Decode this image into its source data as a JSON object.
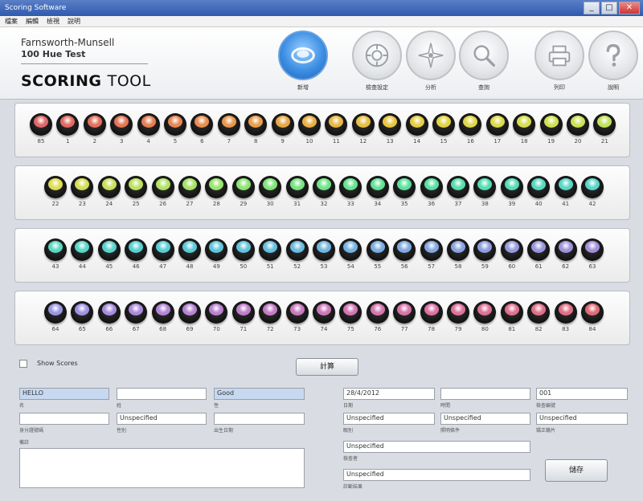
{
  "window": {
    "title": "Scoring Software",
    "min": "_",
    "max": "□",
    "close": "✕"
  },
  "menu": [
    "檔案",
    "編輯",
    "檢視",
    "說明"
  ],
  "brand": {
    "line1": "Farnsworth-Munsell",
    "line2": "100 Hue Test",
    "line3a": "SCORING",
    "line3b": "TOOL"
  },
  "toolbar": [
    {
      "id": "new",
      "label": "新增",
      "icon": "ring-icon",
      "active": true
    },
    {
      "id": "settings",
      "label": "檢查設定",
      "icon": "dial-icon",
      "active": false
    },
    {
      "id": "compass",
      "label": "分析",
      "icon": "compass-icon",
      "active": false
    },
    {
      "id": "search",
      "label": "查詢",
      "icon": "magnifier-icon",
      "active": false
    },
    {
      "id": "print",
      "label": "列印",
      "icon": "printer-icon",
      "active": false
    },
    {
      "id": "help",
      "label": "說明",
      "icon": "question-icon",
      "active": false
    }
  ],
  "caps": {
    "row1": [
      "85",
      "1",
      "2",
      "3",
      "4",
      "5",
      "6",
      "7",
      "8",
      "9",
      "10",
      "11",
      "12",
      "13",
      "14",
      "15",
      "16",
      "17",
      "18",
      "19",
      "20",
      "21"
    ],
    "row2": [
      "22",
      "23",
      "24",
      "25",
      "26",
      "27",
      "28",
      "29",
      "30",
      "31",
      "32",
      "33",
      "34",
      "35",
      "36",
      "37",
      "38",
      "39",
      "40",
      "41",
      "42"
    ],
    "row3": [
      "43",
      "44",
      "45",
      "46",
      "47",
      "48",
      "49",
      "50",
      "51",
      "52",
      "53",
      "54",
      "55",
      "56",
      "57",
      "58",
      "59",
      "60",
      "61",
      "62",
      "63"
    ],
    "row4": [
      "64",
      "65",
      "66",
      "67",
      "68",
      "69",
      "70",
      "71",
      "72",
      "73",
      "74",
      "75",
      "76",
      "77",
      "78",
      "79",
      "80",
      "81",
      "82",
      "83",
      "84"
    ]
  },
  "showScores": "Show Scores",
  "scoreButton": "計算",
  "saveButton": "儲存",
  "form": {
    "name": "HELLO",
    "nameLabel": "名",
    "middle": "",
    "middleLabel": "姓",
    "status": "Good",
    "statusLabel": "性",
    "id": "",
    "idLabel": "身分證號碼",
    "sex": "Unspecified",
    "sexLabel": "性別",
    "age": "",
    "ageLabel": "出生日期",
    "notesLabel": "備註",
    "date": "28/4/2012",
    "dateLabel": "日期",
    "field2": "",
    "field2Label": "時間",
    "field3": "001",
    "field3Label": "檢查編號",
    "eye": "Unspecified",
    "eyeLabel": "眼別",
    "light": "Unspecified",
    "lightLabel": "照明條件",
    "lens": "Unspecified",
    "lensLabel": "矯正鏡片",
    "examiner": "Unspecified",
    "examinerLabel": "檢查者",
    "diag": "Unspecified",
    "diagLabel": "診斷結果"
  },
  "colors": {
    "row1": [
      "#e06868",
      "#e26a62",
      "#e56f5c",
      "#e67658",
      "#e77f55",
      "#e88752",
      "#e98f50",
      "#ea974d",
      "#ea9f4b",
      "#eaa748",
      "#eaaf46",
      "#eab744",
      "#e9bf43",
      "#e8c643",
      "#e6cd44",
      "#e3d346",
      "#e0d748",
      "#dcdb4b",
      "#d7de4e",
      "#d1e052",
      "#cae256",
      "#c2e35a"
    ],
    "row2": [
      "#dedc52",
      "#d4de56",
      "#c9e05a",
      "#bde15e",
      "#b1e263",
      "#a5e368",
      "#99e46e",
      "#8de474",
      "#82e47a",
      "#78e481",
      "#6fe488",
      "#67e38f",
      "#61e296",
      "#5ce19d",
      "#58e0a4",
      "#56dfab",
      "#55ddb2",
      "#55dbb8",
      "#56d9be",
      "#58d7c3",
      "#5ad5c8"
    ],
    "row3": [
      "#5ad8c0",
      "#58d6c6",
      "#57d3cc",
      "#57d0d1",
      "#58cdd6",
      "#5acad9",
      "#5dc6dc",
      "#61c2de",
      "#66bee0",
      "#6bbae1",
      "#70b6e2",
      "#75b2e2",
      "#7aaee2",
      "#7faae2",
      "#84a6e2",
      "#89a2e1",
      "#8e9ee0",
      "#939adf",
      "#9896dd",
      "#9d92db",
      "#a28ed9"
    ],
    "row4": [
      "#9c96e2",
      "#a192e0",
      "#a68edd",
      "#ab8ada",
      "#b087d6",
      "#b584d2",
      "#ba81ce",
      "#bf7ec9",
      "#c47cc4",
      "#c87abf",
      "#cc78ba",
      "#d076b4",
      "#d475ae",
      "#d774a8",
      "#da73a2",
      "#dc729c",
      "#de7196",
      "#df7090",
      "#e06f8a",
      "#e06e84",
      "#e06b74"
    ]
  }
}
